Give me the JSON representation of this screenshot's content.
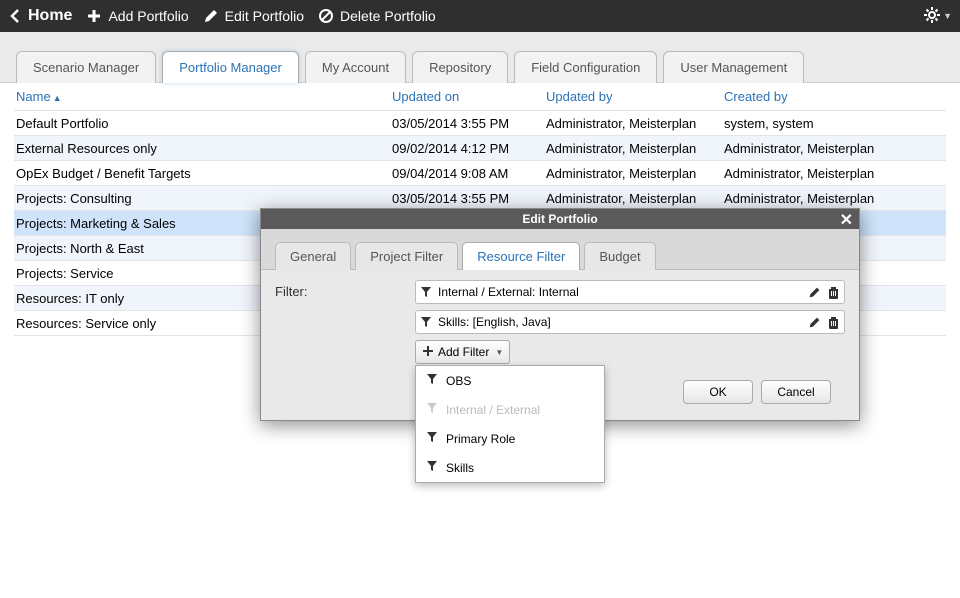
{
  "topbar": {
    "home": "Home",
    "add": "Add Portfolio",
    "edit": "Edit Portfolio",
    "delete": "Delete Portfolio"
  },
  "tabs": {
    "scenario": "Scenario Manager",
    "portfolio": "Portfolio Manager",
    "account": "My Account",
    "repository": "Repository",
    "fieldcfg": "Field Configuration",
    "usermgmt": "User Management"
  },
  "columns": {
    "name": "Name",
    "updated_on": "Updated on",
    "updated_by": "Updated by",
    "created_by": "Created by"
  },
  "rows": [
    {
      "name": "Default Portfolio",
      "updated": "03/05/2014 3:55 PM",
      "uby": "Administrator, Meisterplan",
      "cby": "system, system"
    },
    {
      "name": "External Resources only",
      "updated": "09/02/2014 4:12 PM",
      "uby": "Administrator, Meisterplan",
      "cby": "Administrator, Meisterplan"
    },
    {
      "name": "OpEx Budget / Benefit Targets",
      "updated": "09/04/2014 9:08 AM",
      "uby": "Administrator, Meisterplan",
      "cby": "Administrator, Meisterplan"
    },
    {
      "name": "Projects: Consulting",
      "updated": "03/05/2014 3:55 PM",
      "uby": "Administrator, Meisterplan",
      "cby": "Administrator, Meisterplan"
    },
    {
      "name": "Projects: Marketing & Sales",
      "updated": "",
      "uby": "",
      "cby": ""
    },
    {
      "name": "Projects: North & East",
      "updated": "",
      "uby": "",
      "cby": ""
    },
    {
      "name": "Projects: Service",
      "updated": "",
      "uby": "",
      "cby": ""
    },
    {
      "name": "Resources: IT only",
      "updated": "",
      "uby": "",
      "cby": ""
    },
    {
      "name": "Resources: Service only",
      "updated": "",
      "uby": "",
      "cby": ""
    }
  ],
  "selected_row_index": 4,
  "modal": {
    "title": "Edit Portfolio",
    "tabs": {
      "general": "General",
      "project": "Project Filter",
      "resource": "Resource Filter",
      "budget": "Budget"
    },
    "filter_label": "Filter:",
    "filters": {
      "f0": "Internal / External: Internal",
      "f1": "Skills: [English, Java]"
    },
    "add_filter": "Add Filter",
    "dropdown": {
      "obs": "OBS",
      "ie": "Internal / External",
      "role": "Primary Role",
      "skills": "Skills"
    },
    "ok": "OK",
    "cancel": "Cancel"
  }
}
